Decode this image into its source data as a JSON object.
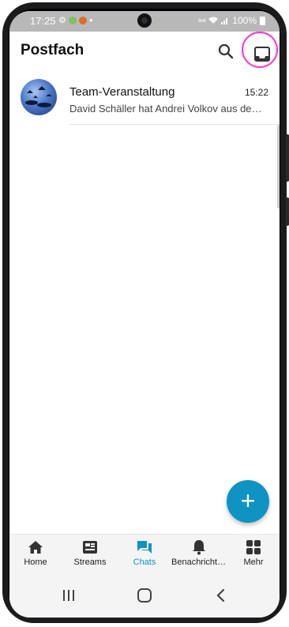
{
  "status_bar": {
    "time": "17:25",
    "battery": "100%"
  },
  "app_bar": {
    "title": "Postfach",
    "search_icon": "search-icon",
    "inbox_icon": "inbox-icon"
  },
  "chats": [
    {
      "name": "Team-Veranstaltung",
      "time": "15:22",
      "preview": "David Schäller hat Andrei Volkov aus de…"
    }
  ],
  "fab": {
    "label": "+"
  },
  "bottom_nav": {
    "items": [
      {
        "label": "Home",
        "icon": "home-icon",
        "active": false
      },
      {
        "label": "Streams",
        "icon": "streams-icon",
        "active": false
      },
      {
        "label": "Chats",
        "icon": "chats-icon",
        "active": true
      },
      {
        "label": "Benachrichti…",
        "icon": "bell-icon",
        "active": false
      },
      {
        "label": "Mehr",
        "icon": "grid-icon",
        "active": false
      }
    ]
  },
  "colors": {
    "accent": "#0e93c2",
    "highlight_ring": "#ff33d6"
  }
}
